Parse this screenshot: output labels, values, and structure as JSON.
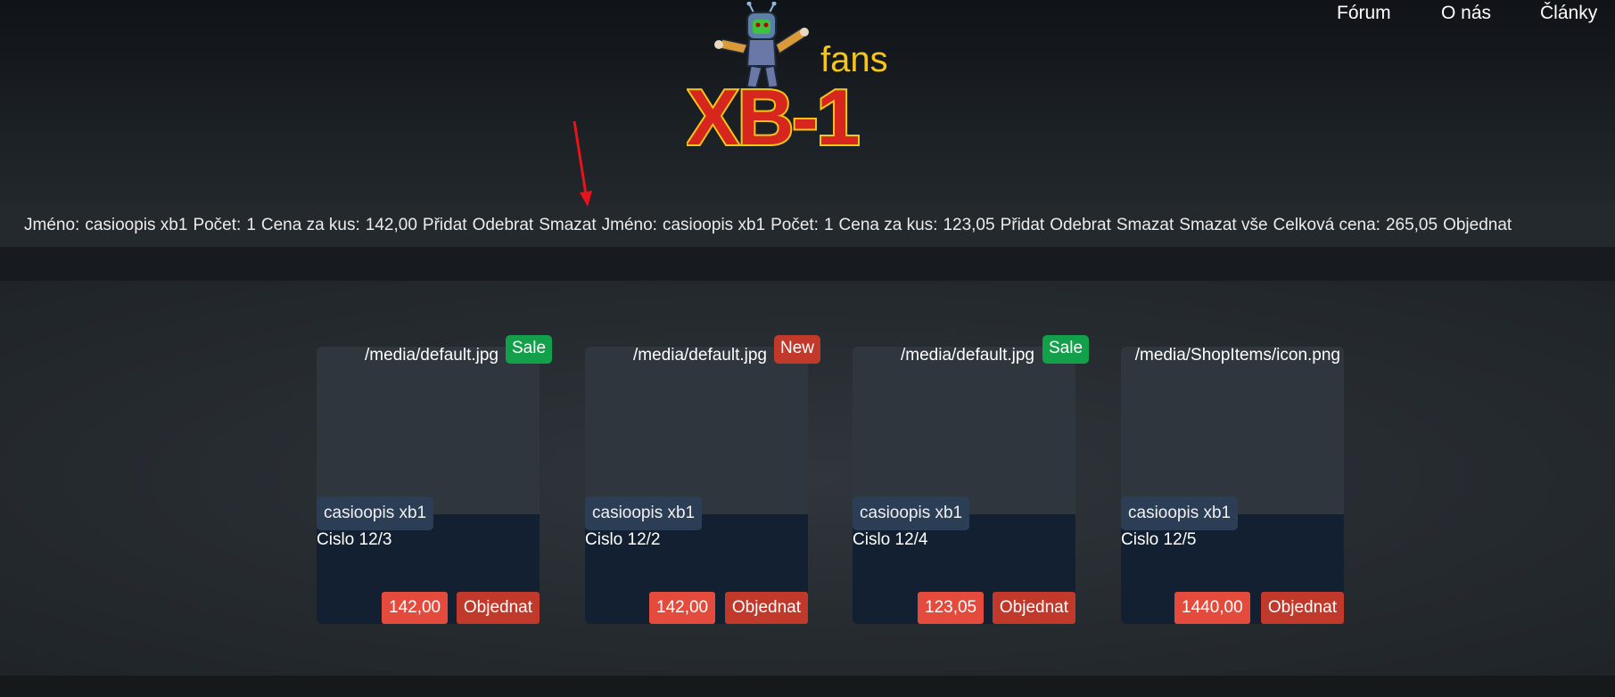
{
  "nav": {
    "forum": "Fórum",
    "about": "O nás",
    "articles": "Články"
  },
  "logo": {
    "text_small": "fans",
    "text_big": "XB-1"
  },
  "cart": {
    "items": [
      {
        "name_label": "Jméno:",
        "name": "casioopis xb1",
        "count_label": "Počet:",
        "count": "1",
        "unit_price_label": "Cena za kus:",
        "unit_price": "142,00",
        "add": "Přidat",
        "remove": "Odebrat",
        "delete": "Smazat"
      },
      {
        "name_label": "Jméno:",
        "name": "casioopis xb1",
        "count_label": "Počet:",
        "count": "1",
        "unit_price_label": "Cena za kus:",
        "unit_price": "123,05",
        "add": "Přidat",
        "remove": "Odebrat",
        "delete": "Smazat"
      }
    ],
    "delete_all": "Smazat vše",
    "total_label": "Celková cena:",
    "total": "265,05",
    "order": "Objednat"
  },
  "products": [
    {
      "image_alt": "/media/default.jpg",
      "badge": "Sale",
      "badge_type": "sale",
      "name": "casioopis xb1",
      "issue": "Cislo 12/3",
      "price": "142,00",
      "order": "Objednat"
    },
    {
      "image_alt": "/media/default.jpg",
      "badge": "New",
      "badge_type": "new",
      "name": "casioopis xb1",
      "issue": "Cislo 12/2",
      "price": "142,00",
      "order": "Objednat"
    },
    {
      "image_alt": "/media/default.jpg",
      "badge": "Sale",
      "badge_type": "sale",
      "name": "casioopis xb1",
      "issue": "Cislo 12/4",
      "price": "123,05",
      "order": "Objednat"
    },
    {
      "image_alt": "/media/ShopItems/icon.png",
      "badge": "",
      "badge_type": "",
      "name": "casioopis xb1",
      "issue": "Cislo 12/5",
      "price": "1440,00",
      "order": "Objednat"
    }
  ],
  "colors": {
    "sale_badge": "#12a04a",
    "new_badge": "#c0392b",
    "price_tag": "#e54b3c",
    "order_button": "#c0392b",
    "card_body": "#132032",
    "logo_yellow": "#f5c518",
    "logo_red": "#d7261e",
    "annotation_arrow": "#e8141c"
  }
}
